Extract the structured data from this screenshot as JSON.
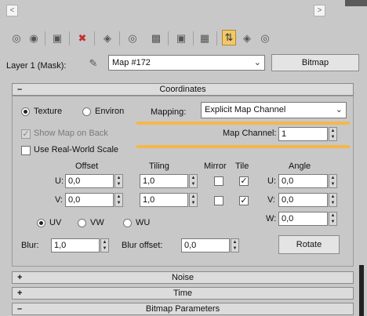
{
  "toolbar": {
    "icons": [
      "get-material-icon",
      "put-to-scene-icon",
      "assign-to-selection-icon",
      "reset-map-icon",
      "make-unique-icon",
      "put-to-library-icon",
      "material-id-icon",
      "show-map-icon",
      "show-end-result-icon",
      "background-icon",
      "go-to-parent-icon",
      "go-forward-icon",
      "sibling-icon"
    ]
  },
  "layer": {
    "label": "Layer 1 (Mask):",
    "map_name": "Map #172",
    "type_button": "Bitmap"
  },
  "coordinates": {
    "title": "Coordinates",
    "sign": "–",
    "texture_label": "Texture",
    "environ_label": "Environ",
    "mapping_label": "Mapping:",
    "mapping_value": "Explicit Map Channel",
    "show_map_on_back": "Show Map on Back",
    "map_channel_label": "Map Channel:",
    "map_channel_value": "1",
    "use_real_world": "Use Real-World Scale",
    "headers": {
      "offset": "Offset",
      "tiling": "Tiling",
      "mirror": "Mirror",
      "tile": "Tile",
      "angle": "Angle"
    },
    "u_label": "U:",
    "v_label": "V:",
    "w_label": "W:",
    "offset_u": "0,0",
    "offset_v": "0,0",
    "tiling_u": "1,0",
    "tiling_v": "1,0",
    "angle_u": "0,0",
    "angle_v": "0,0",
    "angle_w": "0,0",
    "uv_label": "UV",
    "vw_label": "VW",
    "wu_label": "WU",
    "blur_label": "Blur:",
    "blur_value": "1,0",
    "blur_offset_label": "Blur offset:",
    "blur_offset_value": "0,0",
    "rotate_button": "Rotate"
  },
  "rollouts": {
    "noise": {
      "sign": "+",
      "title": "Noise"
    },
    "time": {
      "sign": "+",
      "title": "Time"
    },
    "bitmap": {
      "sign": "–",
      "title": "Bitmap Parameters"
    }
  },
  "colors": {
    "highlight": "#f5b74a",
    "panel": "#c8c8c8"
  }
}
